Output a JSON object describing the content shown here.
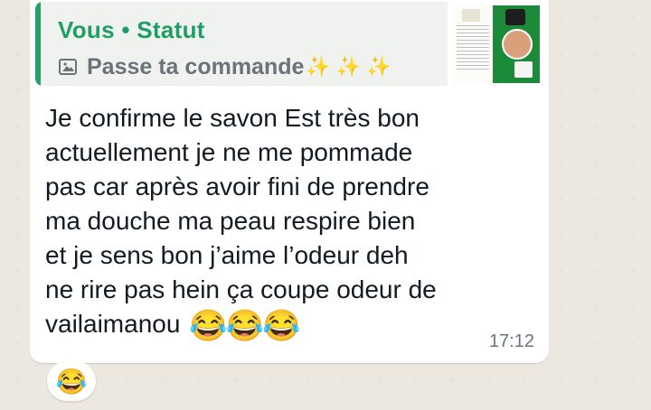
{
  "quoted_status": {
    "author": "Vous • Statut",
    "media_icon": "image-icon",
    "text": "Passe ta commande",
    "sparkles": "✨✨✨"
  },
  "message": {
    "text": "Je confirme le savon Est très bon\nactuellement je ne me pommade\npas car après avoir fini de prendre\nma douche ma peau respire bien\net je sens bon j’aime l’odeur deh\nne rire pas hein ça coupe odeur de\nvailaimanou",
    "emojis": "😂😂😂",
    "time": "17:12"
  },
  "reaction": {
    "emoji": "😂"
  },
  "colors": {
    "accent": "#25a366",
    "author_text": "#1f9e63",
    "background": "#ece7df"
  }
}
